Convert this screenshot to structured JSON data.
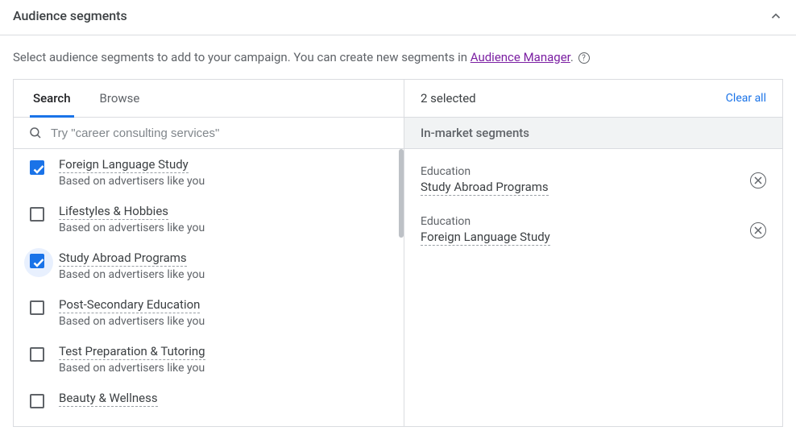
{
  "header": {
    "title": "Audience segments"
  },
  "instruction": {
    "prefix": "Select audience segments to add to your campaign. You can create new segments in ",
    "link_text": "Audience Manager",
    "suffix": ". "
  },
  "tabs": {
    "search": "Search",
    "browse": "Browse"
  },
  "search": {
    "placeholder": "Try \"career consulting services\""
  },
  "list": {
    "items": [
      {
        "title": "Foreign Language Study",
        "sub": "Based on advertisers like you",
        "checked": true,
        "halo": false
      },
      {
        "title": "Lifestyles & Hobbies",
        "sub": "Based on advertisers like you",
        "checked": false,
        "halo": false
      },
      {
        "title": "Study Abroad Programs",
        "sub": "Based on advertisers like you",
        "checked": true,
        "halo": true
      },
      {
        "title": "Post-Secondary Education",
        "sub": "Based on advertisers like you",
        "checked": false,
        "halo": false
      },
      {
        "title": "Test Preparation & Tutoring",
        "sub": "Based on advertisers like you",
        "checked": false,
        "halo": false
      },
      {
        "title": "Beauty & Wellness",
        "sub": "",
        "checked": false,
        "halo": false
      }
    ]
  },
  "right": {
    "selected_label": "2 selected",
    "clear_all": "Clear all",
    "subheader": "In-market segments",
    "selected": [
      {
        "category": "Education",
        "title": "Study Abroad Programs"
      },
      {
        "category": "Education",
        "title": "Foreign Language Study"
      }
    ]
  }
}
